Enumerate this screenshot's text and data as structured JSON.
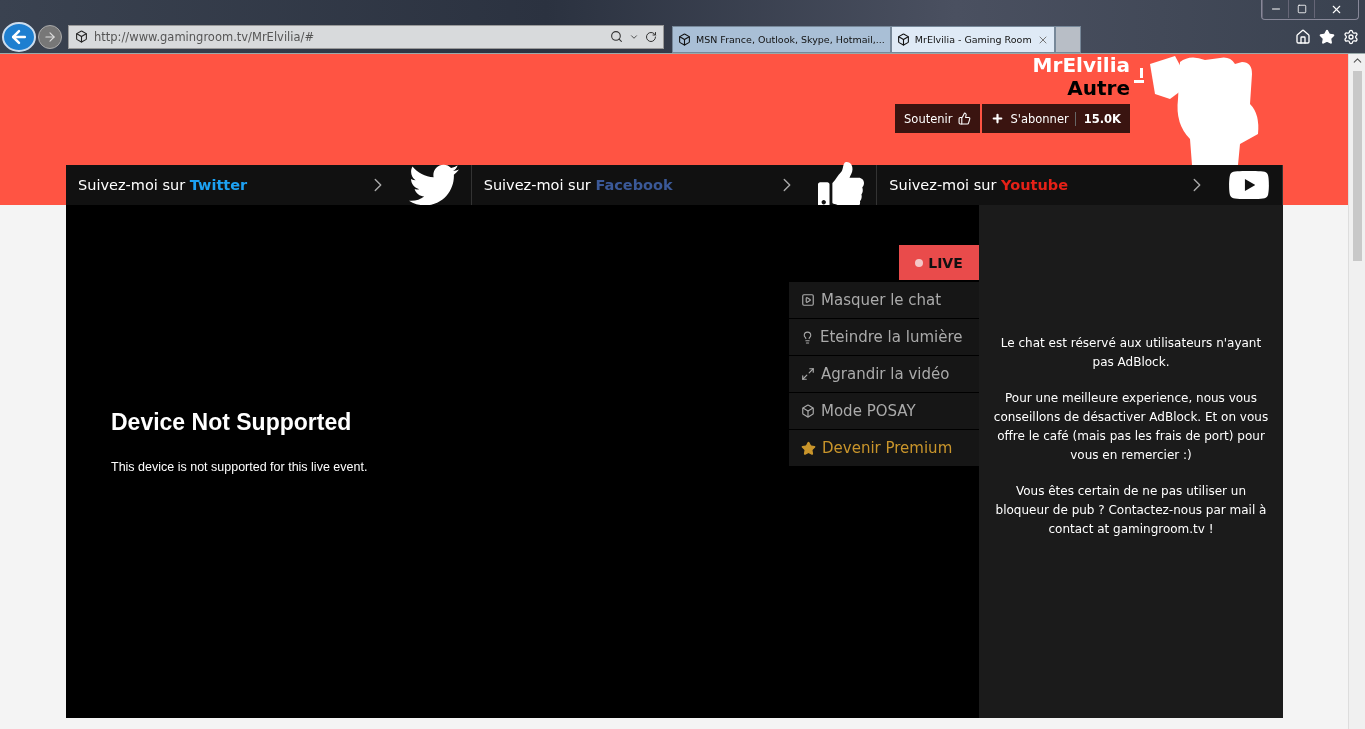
{
  "browser": {
    "address": "http://www.gamingroom.tv/MrElvilia/#",
    "tabs": [
      {
        "title": "MSN France, Outlook, Skype, Hotmail,...",
        "selected": false
      },
      {
        "title": "MrElvilia - Gaming Room",
        "selected": true
      }
    ]
  },
  "channel": {
    "name": "MrElvilia",
    "category": "Autre",
    "support_label": "Soutenir",
    "subscribe_label": "S'abonner",
    "subscribers": "15.0K"
  },
  "social": [
    {
      "kind": "twitter",
      "prefix": "Suivez-moi sur",
      "network": "Twitter",
      "color": "#1da1f2"
    },
    {
      "kind": "facebook",
      "prefix": "Suivez-moi sur",
      "network": "Facebook",
      "color": "#3b5998"
    },
    {
      "kind": "youtube",
      "prefix": "Suivez-moi sur",
      "network": "Youtube",
      "color": "#e62117"
    }
  ],
  "player": {
    "title": "Device Not Supported",
    "message": "This device is not supported for this live event.",
    "live_label": "LIVE",
    "menu": [
      {
        "kind": "chat",
        "label": "Masquer le chat"
      },
      {
        "kind": "light",
        "label": "Eteindre la lumière"
      },
      {
        "kind": "expand",
        "label": "Agrandir la vidéo"
      },
      {
        "kind": "posay",
        "label": "Mode POSAY"
      },
      {
        "kind": "premium",
        "label": "Devenir Premium"
      }
    ]
  },
  "chat": {
    "paragraphs": [
      "Le chat est réservé aux utilisateurs n'ayant pas AdBlock.",
      "Pour une meilleure experience, nous vous conseillons de désactiver AdBlock. Et on vous offre le café (mais pas les frais de port) pour vous en remercier :)",
      "Vous êtes certain de ne pas utiliser un bloqueur de pub ? Contactez-nous par mail à contact at gamingroom.tv !"
    ]
  }
}
